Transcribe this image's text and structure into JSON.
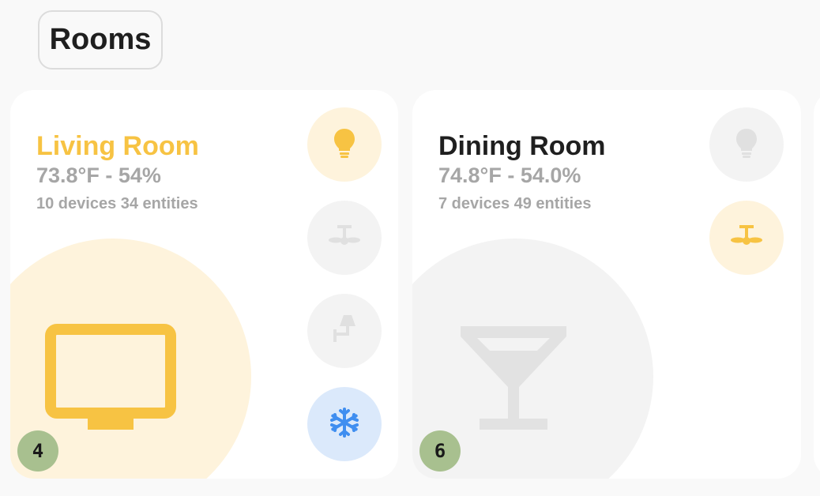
{
  "section": {
    "title": "Rooms"
  },
  "colors": {
    "accent_yellow": "#f7c343",
    "accent_yellow_bg": "#fef3dc",
    "accent_blue": "#3f8ef0",
    "accent_blue_bg": "#dbe9fb",
    "off_gray": "#e0e0e0",
    "off_gray_bg": "#f3f3f3",
    "badge_green": "#a8c08f"
  },
  "rooms": [
    {
      "name": "Living Room",
      "climate": "73.8°F - 54%",
      "counts": "10 devices 34 entities",
      "active": true,
      "room_icon": "television-icon",
      "badge": "4",
      "entities": [
        {
          "icon": "lightbulb-icon",
          "state": "on"
        },
        {
          "icon": "ceiling-fan-icon",
          "state": "off"
        },
        {
          "icon": "wall-lamp-icon",
          "state": "off"
        },
        {
          "icon": "snowflake-icon",
          "state": "on"
        }
      ]
    },
    {
      "name": "Dining Room",
      "climate": "74.8°F - 54.0%",
      "counts": "7 devices 49 entities",
      "active": false,
      "room_icon": "cocktail-glass-icon",
      "badge": "6",
      "entities": [
        {
          "icon": "lightbulb-icon",
          "state": "off"
        },
        {
          "icon": "ceiling-fan-icon",
          "state": "on"
        }
      ]
    }
  ]
}
